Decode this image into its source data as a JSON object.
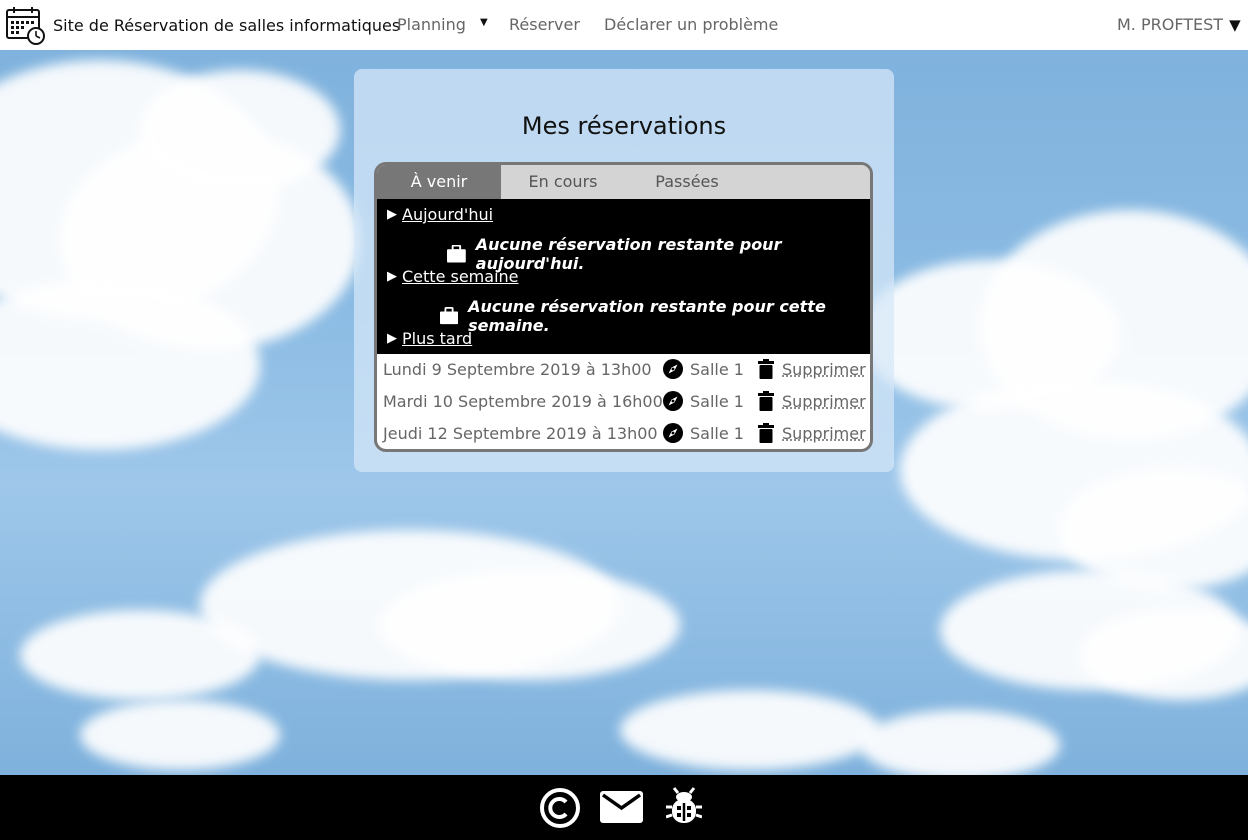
{
  "navbar": {
    "title": "Site de Réservation de salles informatiques",
    "planning": "Planning",
    "reserver": "Réserver",
    "declarer": "Déclarer un problème",
    "user": "M. PROFTEST"
  },
  "card": {
    "title": "Mes réservations",
    "tabs": [
      "À venir",
      "En cours",
      "Passées"
    ],
    "active_tab": "À venir"
  },
  "groups": {
    "today": {
      "label": "Aujourd'hui",
      "empty": "Aucune réservation restante pour aujourd'hui."
    },
    "week": {
      "label": "Cette semaine",
      "empty": "Aucune réservation restante pour cette semaine."
    },
    "later": {
      "label": "Plus tard"
    }
  },
  "reservations": [
    {
      "date": "Lundi 9 Septembre 2019 à 13h00",
      "room": "Salle 1",
      "delete": "Supprimer"
    },
    {
      "date": "Mardi 10 Septembre 2019 à 16h00",
      "room": "Salle 1",
      "delete": "Supprimer"
    },
    {
      "date": "Jeudi 12 Septembre 2019 à 13h00",
      "room": "Salle 1",
      "delete": "Supprimer"
    }
  ],
  "colors": {
    "tab_active": "#777777",
    "tab_bar": "#d4d4d4",
    "section_bg": "#000000",
    "footer_bg": "#000000"
  },
  "icons": {
    "brand": "calendar-clock-icon",
    "empty": "briefcase-icon",
    "room": "compass-icon",
    "delete": "trash-icon",
    "footer": [
      "copyright-icon",
      "mail-icon",
      "bug-icon"
    ]
  }
}
